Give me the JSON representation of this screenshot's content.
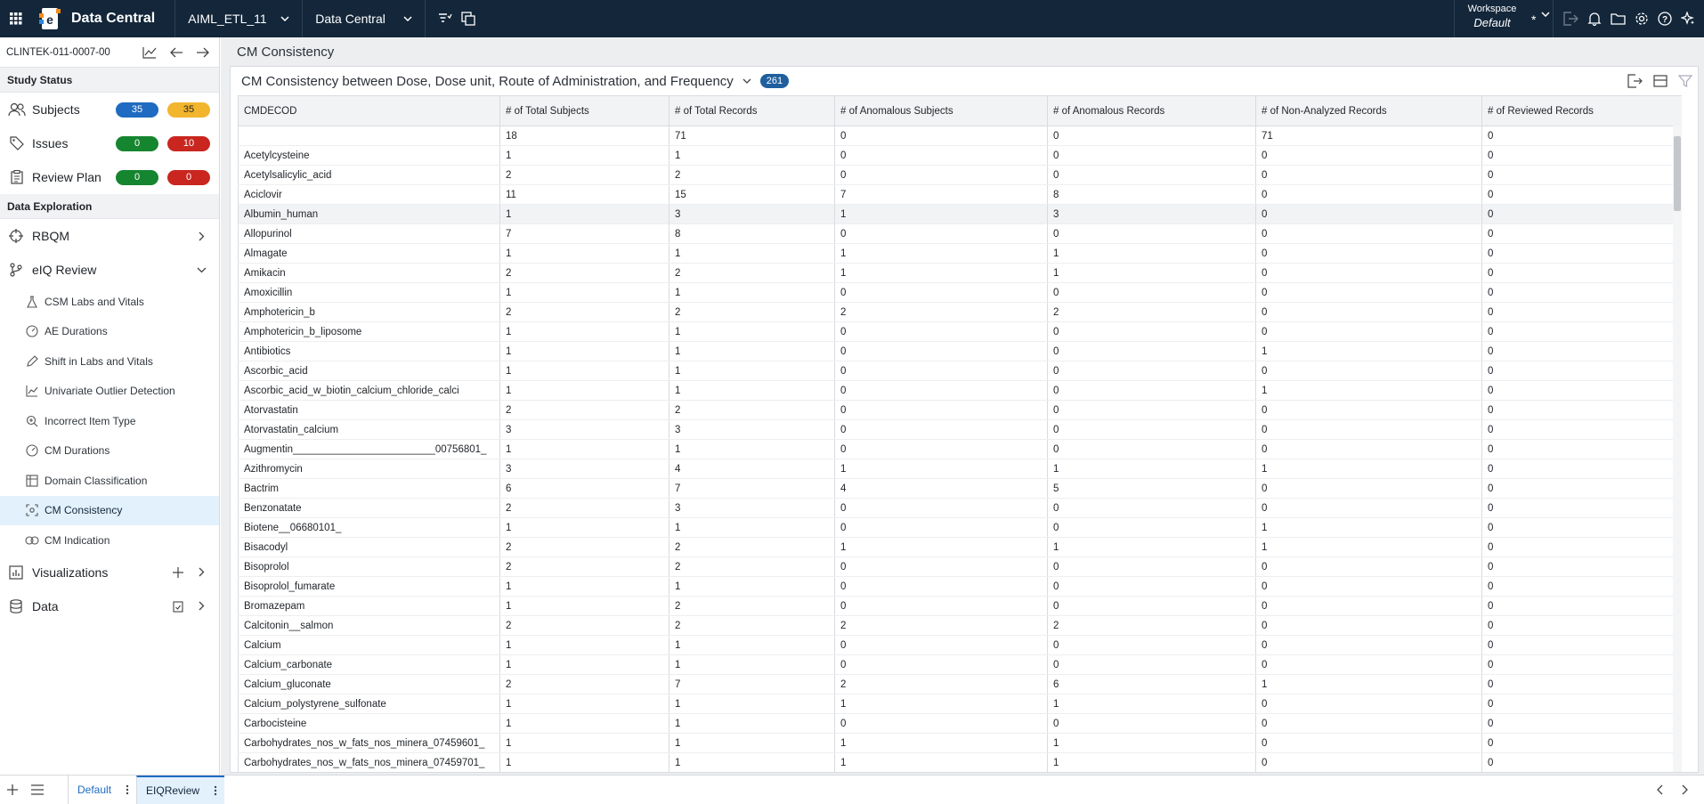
{
  "topbar": {
    "app_name": "Data Central",
    "project_select": "AIML_ETL_11",
    "module_select": "Data Central",
    "workspace_label": "Workspace",
    "workspace_value": "Default",
    "workspace_modified": "*"
  },
  "sidebar": {
    "study_id": "CLINTEK-011-0007-00",
    "study_status_title": "Study Status",
    "stats": [
      {
        "label": "Subjects",
        "a": "35",
        "b": "35"
      },
      {
        "label": "Issues",
        "a": "0",
        "b": "10"
      },
      {
        "label": "Review Plan",
        "a": "0",
        "b": "0"
      }
    ],
    "data_exploration_title": "Data Exploration",
    "rbqm": "RBQM",
    "eiq_review": "eIQ Review",
    "sub_items": [
      "CSM Labs and Vitals",
      "AE Durations",
      "Shift in Labs and Vitals",
      "Univariate Outlier Detection",
      "Incorrect Item Type",
      "CM Durations",
      "Domain Classification",
      "CM Consistency",
      "CM Indication"
    ],
    "visualizations": "Visualizations",
    "data": "Data"
  },
  "main": {
    "page_title": "CM Consistency",
    "panel_title": "CM Consistency between Dose, Dose unit, Route of Administration, and Frequency",
    "count": "261",
    "columns": [
      "CMDECOD",
      "# of Total Subjects",
      "# of Total Records",
      "# of Anomalous Subjects",
      "# of Anomalous Records",
      "# of Non-Analyzed Records",
      "# of Reviewed Records"
    ],
    "rows": [
      [
        "",
        "18",
        "71",
        "0",
        "0",
        "71",
        "0"
      ],
      [
        "Acetylcysteine",
        "1",
        "1",
        "0",
        "0",
        "0",
        "0"
      ],
      [
        "Acetylsalicylic_acid",
        "2",
        "2",
        "0",
        "0",
        "0",
        "0"
      ],
      [
        "Aciclovir",
        "11",
        "15",
        "7",
        "8",
        "0",
        "0"
      ],
      [
        "Albumin_human",
        "1",
        "3",
        "1",
        "3",
        "0",
        "0"
      ],
      [
        "Allopurinol",
        "7",
        "8",
        "0",
        "0",
        "0",
        "0"
      ],
      [
        "Almagate",
        "1",
        "1",
        "1",
        "1",
        "0",
        "0"
      ],
      [
        "Amikacin",
        "2",
        "2",
        "1",
        "1",
        "0",
        "0"
      ],
      [
        "Amoxicillin",
        "1",
        "1",
        "0",
        "0",
        "0",
        "0"
      ],
      [
        "Amphotericin_b",
        "2",
        "2",
        "2",
        "2",
        "0",
        "0"
      ],
      [
        "Amphotericin_b_liposome",
        "1",
        "1",
        "0",
        "0",
        "0",
        "0"
      ],
      [
        "Antibiotics",
        "1",
        "1",
        "0",
        "0",
        "1",
        "0"
      ],
      [
        "Ascorbic_acid",
        "1",
        "1",
        "0",
        "0",
        "0",
        "0"
      ],
      [
        "Ascorbic_acid_w_biotin_calcium_chloride_calci",
        "1",
        "1",
        "0",
        "0",
        "1",
        "0"
      ],
      [
        "Atorvastatin",
        "2",
        "2",
        "0",
        "0",
        "0",
        "0"
      ],
      [
        "Atorvastatin_calcium",
        "3",
        "3",
        "0",
        "0",
        "0",
        "0"
      ],
      [
        "Augmentin_________________________00756801_",
        "1",
        "1",
        "0",
        "0",
        "0",
        "0"
      ],
      [
        "Azithromycin",
        "3",
        "4",
        "1",
        "1",
        "1",
        "0"
      ],
      [
        "Bactrim",
        "6",
        "7",
        "4",
        "5",
        "0",
        "0"
      ],
      [
        "Benzonatate",
        "2",
        "3",
        "0",
        "0",
        "0",
        "0"
      ],
      [
        "Biotene__06680101_",
        "1",
        "1",
        "0",
        "0",
        "1",
        "0"
      ],
      [
        "Bisacodyl",
        "2",
        "2",
        "1",
        "1",
        "1",
        "0"
      ],
      [
        "Bisoprolol",
        "2",
        "2",
        "0",
        "0",
        "0",
        "0"
      ],
      [
        "Bisoprolol_fumarate",
        "1",
        "1",
        "0",
        "0",
        "0",
        "0"
      ],
      [
        "Bromazepam",
        "1",
        "2",
        "0",
        "0",
        "0",
        "0"
      ],
      [
        "Calcitonin__salmon",
        "2",
        "2",
        "2",
        "2",
        "0",
        "0"
      ],
      [
        "Calcium",
        "1",
        "1",
        "0",
        "0",
        "0",
        "0"
      ],
      [
        "Calcium_carbonate",
        "1",
        "1",
        "0",
        "0",
        "0",
        "0"
      ],
      [
        "Calcium_gluconate",
        "2",
        "7",
        "2",
        "6",
        "1",
        "0"
      ],
      [
        "Calcium_polystyrene_sulfonate",
        "1",
        "1",
        "1",
        "1",
        "0",
        "0"
      ],
      [
        "Carbocisteine",
        "1",
        "1",
        "0",
        "0",
        "0",
        "0"
      ],
      [
        "Carbohydrates_nos_w_fats_nos_minera_07459601_",
        "1",
        "1",
        "1",
        "1",
        "0",
        "0"
      ],
      [
        "Carbohydrates_nos_w_fats_nos_minera_07459701_",
        "1",
        "1",
        "1",
        "1",
        "0",
        "0"
      ]
    ],
    "hover_row": 4
  },
  "bottombar": {
    "tabs": [
      "Default",
      "EIQReview"
    ],
    "active_tab": "EIQReview"
  }
}
